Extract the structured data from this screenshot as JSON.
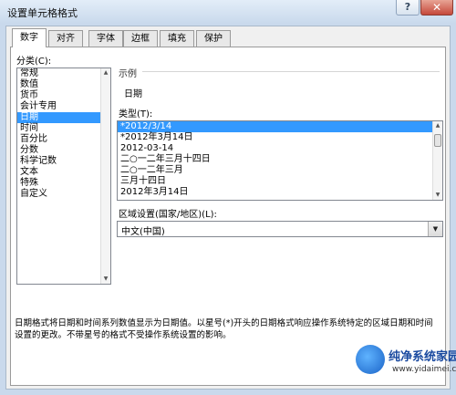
{
  "window": {
    "title": "设置单元格格式",
    "help_label": "?",
    "close_label": "✕"
  },
  "tabs": [
    {
      "label": "数字"
    },
    {
      "label": "对齐"
    },
    {
      "label": "字体"
    },
    {
      "label": "边框"
    },
    {
      "label": "填充"
    },
    {
      "label": "保护"
    }
  ],
  "category": {
    "label": "分类(C):",
    "items": [
      "常规",
      "数值",
      "货币",
      "会计专用",
      "日期",
      "时间",
      "百分比",
      "分数",
      "科学记数",
      "文本",
      "特殊",
      "自定义"
    ],
    "selected_index": 4
  },
  "sample": {
    "label": "示例",
    "value": "日期"
  },
  "type": {
    "label": "类型(T):",
    "items": [
      "*2012/3/14",
      "*2012年3月14日",
      "2012-03-14",
      "二○一二年三月十四日",
      "二○一二年三月",
      "三月十四日",
      "2012年3月14日"
    ],
    "selected_index": 0
  },
  "locale": {
    "label": "区域设置(国家/地区)(L):",
    "value": "中文(中国)"
  },
  "description": "日期格式将日期和时间系列数值显示为日期值。以星号(*)开头的日期格式响应操作系统特定的区域日期和时间设置的更改。不带星号的格式不受操作系统设置的影响。",
  "watermark": {
    "text": "纯净系统家园",
    "url": "www.yidaimei.com"
  }
}
